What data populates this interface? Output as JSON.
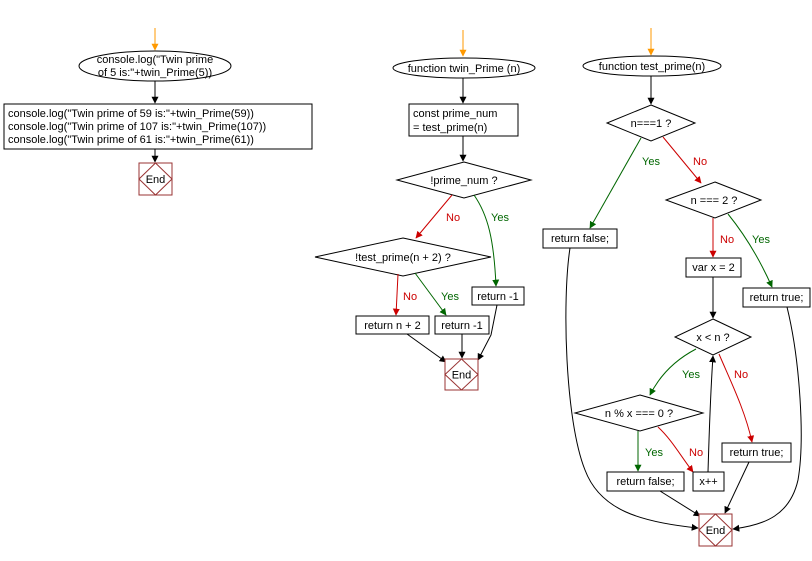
{
  "colors": {
    "start_arrow": "#ff9900",
    "yes_branch": "#006600",
    "no_branch": "#cc0000",
    "end_node": "#993333",
    "default": "#000000"
  },
  "branch_labels": {
    "yes": "Yes",
    "no": "No"
  },
  "main_flow": {
    "start_line1": "console.log(\"Twin prime",
    "start_line2": "of 5 is:\"+twin_Prime(5))",
    "calls": [
      "console.log(\"Twin prime of 59 is:\"+twin_Prime(59))",
      "console.log(\"Twin prime of 107 is:\"+twin_Prime(107))",
      "console.log(\"Twin prime of 61 is:\"+twin_Prime(61))"
    ],
    "end": "End"
  },
  "twin_prime_flow": {
    "start": "function twin_Prime (n)",
    "assign_line1": "const prime_num",
    "assign_line2": "= test_prime(n)",
    "decision1": "!prime_num ?",
    "decision2": "!test_prime(n + 2) ?",
    "return_neg1_a": "return -1",
    "return_n_plus_2": "return n + 2",
    "return_neg1_b": "return -1",
    "end": "End"
  },
  "test_prime_flow": {
    "start": "function test_prime(n)",
    "decision_eq1": "n===1 ?",
    "decision_eq2": "n === 2 ?",
    "return_false_1": "return false;",
    "var_x": "var x = 2",
    "return_true_1": "return true;",
    "decision_loop": "x < n ?",
    "decision_mod": "n % x === 0 ?",
    "return_true_2": "return true;",
    "return_false_2": "return false;",
    "increment": "x++",
    "end": "End"
  }
}
